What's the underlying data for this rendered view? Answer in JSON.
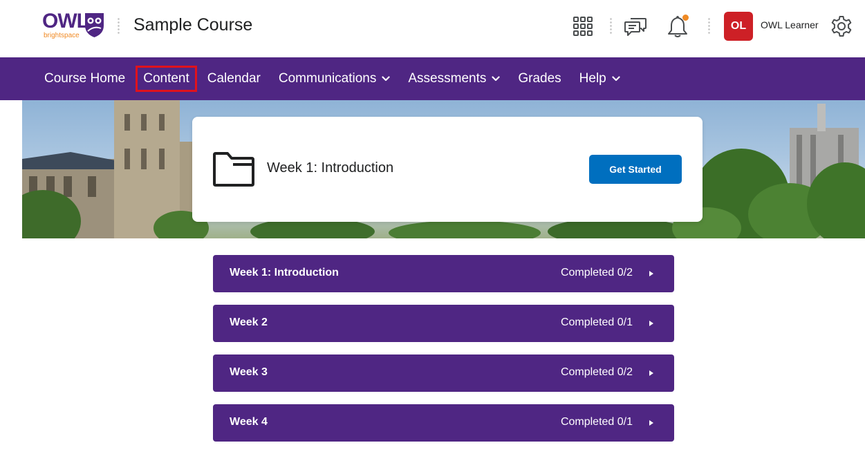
{
  "header": {
    "logo_text": "OWL",
    "logo_subtext": "brightspace",
    "course_title": "Sample Course",
    "user_initials": "OL",
    "user_name": "OWL Learner",
    "icons": [
      "apps-grid-icon",
      "messages-icon",
      "bell-icon",
      "gear-icon"
    ],
    "notification_dot_color": "#f08a24",
    "avatar_color": "#cd2026"
  },
  "nav": {
    "items": [
      {
        "label": "Course Home",
        "dropdown": false
      },
      {
        "label": "Content",
        "dropdown": false,
        "highlighted": true
      },
      {
        "label": "Calendar",
        "dropdown": false
      },
      {
        "label": "Communications",
        "dropdown": true
      },
      {
        "label": "Assessments",
        "dropdown": true
      },
      {
        "label": "Grades",
        "dropdown": false
      },
      {
        "label": "Help",
        "dropdown": true
      }
    ],
    "background": "#4f2683",
    "highlight_color": "#e0121c"
  },
  "hero": {
    "card_title": "Week 1: Introduction",
    "button_label": "Get Started",
    "button_color": "#006fbf",
    "icon": "folder-icon"
  },
  "modules": [
    {
      "name": "Week 1: Introduction",
      "status": "Completed 0/2"
    },
    {
      "name": "Week 2",
      "status": "Completed 0/1"
    },
    {
      "name": "Week 3",
      "status": "Completed 0/2"
    },
    {
      "name": "Week 4",
      "status": "Completed 0/1"
    }
  ]
}
